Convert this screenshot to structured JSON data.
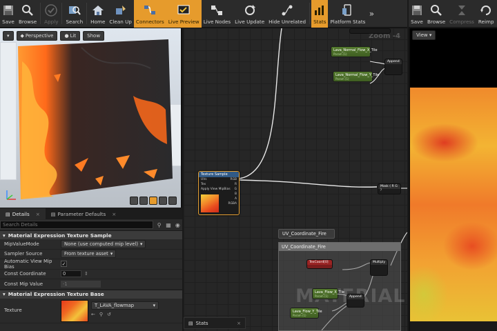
{
  "toolbar": {
    "main_buttons": [
      {
        "label": "Save",
        "icon": "save-icon"
      },
      {
        "label": "Browse",
        "icon": "browse-icon"
      },
      {
        "label": "Apply",
        "icon": "apply-icon"
      },
      {
        "label": "Search",
        "icon": "search-icon"
      },
      {
        "label": "Home",
        "icon": "home-icon"
      },
      {
        "label": "Clean Up",
        "icon": "clean-up-icon"
      },
      {
        "label": "Connectors",
        "icon": "connectors-icon"
      },
      {
        "label": "Live Preview",
        "icon": "live-preview-icon"
      },
      {
        "label": "Live Nodes",
        "icon": "live-nodes-icon"
      },
      {
        "label": "Live Update",
        "icon": "live-update-icon"
      },
      {
        "label": "Hide Unrelated",
        "icon": "hide-unrelated-icon"
      },
      {
        "label": "Stats",
        "icon": "stats-icon"
      },
      {
        "label": "Platform Stats",
        "icon": "platform-stats-icon"
      }
    ],
    "preview_buttons": [
      {
        "label": "Save"
      },
      {
        "label": "Browse"
      },
      {
        "label": "Compress"
      },
      {
        "label": "Reimp"
      }
    ],
    "more_glyph": "»"
  },
  "viewport": {
    "perspective": "Perspective",
    "lit": "Lit",
    "show": "Show"
  },
  "details": {
    "tab_details": "Details",
    "tab_params": "Parameter Defaults",
    "search_placeholder": "Search Details",
    "section1": "Material Expression Texture Sample",
    "mip_label": "MipValueMode",
    "mip_value": "None (use computed mip level)",
    "sampler_label": "Sampler Source",
    "sampler_value": "From texture asset",
    "auto_bias_label": "Automatic View Mip Bias",
    "auto_bias_checked": true,
    "const_coord_label": "Const Coordinate",
    "const_coord_value": "0",
    "const_mip_label": "Const Mip Value",
    "const_mip_value": "-1",
    "section2": "Material Expression Texture Base",
    "texture_label": "Texture",
    "texture_value": "T_LAVA_flowmap"
  },
  "graph": {
    "zoom": "Zoom -4",
    "texture_sample_title": "Texture Sample",
    "ts_pins": [
      "UVs",
      "Tex",
      "Apply View MipBias"
    ],
    "ts_outputs": [
      "RGB",
      "R",
      "G",
      "B",
      "A",
      "RGBA"
    ],
    "param_nodes": [
      {
        "name": "Lava_Normal_Flow_X_Tile",
        "sub": "Param (1)"
      },
      {
        "name": "Lava_Normal_Flow_Y_Tile",
        "sub": "Param (1)"
      },
      {
        "name": "Lava_Flow_X_Tile",
        "sub": "Param (1)"
      },
      {
        "name": "Lava_Flow_Y_Tile",
        "sub": "Param (1)"
      }
    ],
    "append_label": "Append",
    "mask_label": "Mask ( R G )",
    "texcoord_label": "TexCoord[0]",
    "multiply_label": "Multiply",
    "comment_tag": "UV_Coordinate_Fire",
    "comment_title": "UV_Coordinate_Fire",
    "watermark": "MATERIAL",
    "stats_tab": "Stats"
  },
  "preview": {
    "view_label": "View"
  },
  "colors": {
    "accent": "#e69b2c",
    "param_green": "#4f7a28",
    "texture_node_head": "#315a86"
  }
}
